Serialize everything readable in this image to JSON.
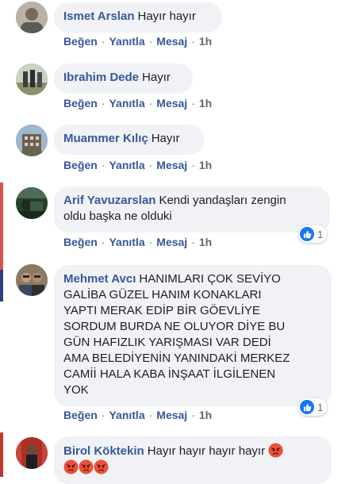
{
  "actions": {
    "like": "Beğen",
    "reply": "Yanıtla",
    "message": "Mesaj",
    "separator": "·"
  },
  "comments": [
    {
      "author": "Ismet Arslan",
      "text": "Hayır hayır",
      "time": "1h"
    },
    {
      "author": "Ibrahim Dede",
      "text": "Hayır",
      "time": "1h"
    },
    {
      "author": "Muammer Kılıç",
      "text": "Hayır",
      "time": "1h"
    },
    {
      "author": "Arif Yavuzarslan",
      "text_line1": "Kendi yandaşları zengin",
      "text_line2": "oldu başka ne olduki",
      "time": "1h",
      "reactions": "1"
    },
    {
      "author": "Mehmet Avcı",
      "lines": [
        "HANIMLARI ÇOK SEVİYO",
        "GALİBA GÜZEL HANIM KONAKLARI",
        "YAPTI MERAK EDİP BİR GÖEVLİYE",
        "SORDUM BURDA NE OLUYOR DİYE BU",
        "GÜN HAFIZLIK YARIŞMASI VAR DEDİ",
        "AMA BELEDİYENİN YANINDAKİ MERKEZ",
        "CAMİİ HALA KABA İNŞAAT İLGİLENEN",
        "YOK"
      ],
      "time": "1h",
      "reactions": "1"
    },
    {
      "author": "Birol Köktekin",
      "text": "Hayır hayır hayır hayır"
    }
  ],
  "colors": {
    "link": "#385898",
    "bubble": "#f0f2f5",
    "like": "#1877f2",
    "angry": "#e9513b"
  }
}
